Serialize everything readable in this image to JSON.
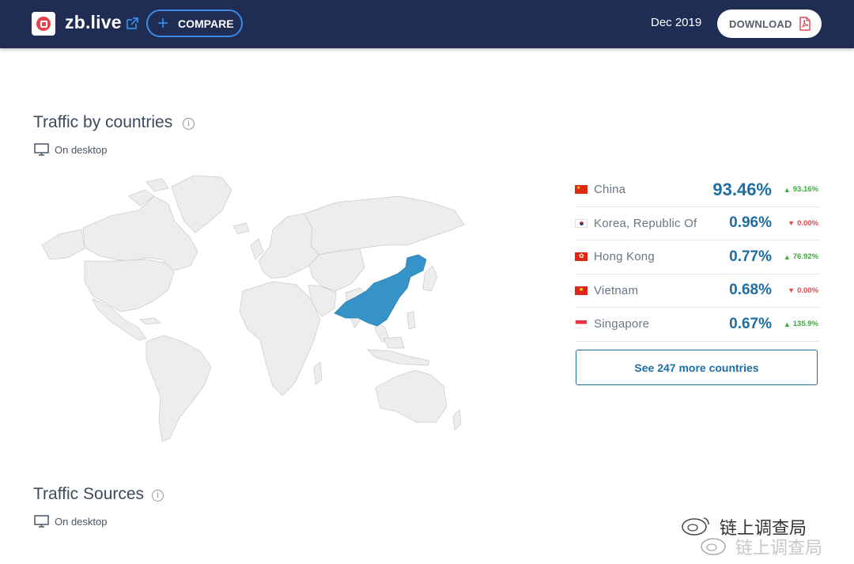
{
  "header": {
    "site_name": "zb.live",
    "compare_label": "COMPARE",
    "date": "Dec 2019",
    "download_label": "DOWNLOAD",
    "bg_color": "#1f2d55",
    "accent_color": "#3b8ae6"
  },
  "traffic_by_countries": {
    "title": "Traffic by countries",
    "device_label": "On desktop",
    "highlighted_country": "China",
    "highlight_color": "#3593c8",
    "countries": [
      {
        "name": "China",
        "share": "93.46%",
        "change": "93.16%",
        "direction": "up",
        "flag": "cn"
      },
      {
        "name": "Korea, Republic Of",
        "share": "0.96%",
        "change": "0.00%",
        "direction": "down",
        "flag": "kr"
      },
      {
        "name": "Hong Kong",
        "share": "0.77%",
        "change": "76.92%",
        "direction": "up",
        "flag": "hk"
      },
      {
        "name": "Vietnam",
        "share": "0.68%",
        "change": "0.00%",
        "direction": "down",
        "flag": "vn"
      },
      {
        "name": "Singapore",
        "share": "0.67%",
        "change": "135.9%",
        "direction": "up",
        "flag": "sg"
      }
    ],
    "more_label": "See 247 more countries"
  },
  "traffic_sources": {
    "title": "Traffic Sources",
    "device_label": "On desktop"
  },
  "watermark": {
    "text": "链上调查局"
  }
}
